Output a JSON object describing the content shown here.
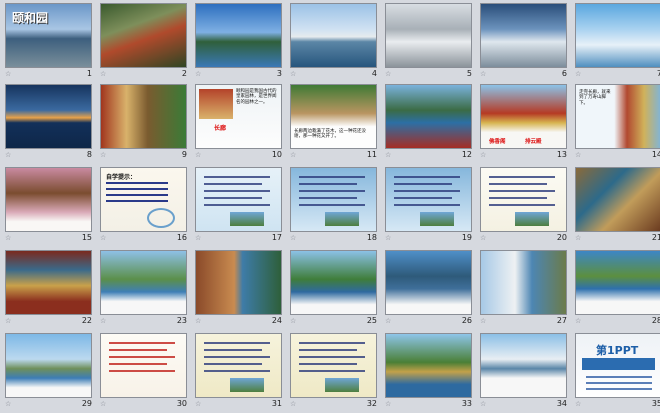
{
  "slides": [
    {
      "n": "1",
      "title": "颐和园",
      "bg": "scene-lake",
      "star": "☆"
    },
    {
      "n": "2",
      "bg": "scene-temple",
      "star": "☆"
    },
    {
      "n": "3",
      "bg": "scene-blue",
      "star": "☆"
    },
    {
      "n": "4",
      "bg": "scene-bridge",
      "star": "☆"
    },
    {
      "n": "5",
      "bg": "scene-winter",
      "star": "☆"
    },
    {
      "n": "6",
      "bg": "scene-snow",
      "star": "☆"
    },
    {
      "n": "7",
      "bg": "scene-bluewinter",
      "star": "☆"
    },
    {
      "n": "8",
      "bg": "scene-sunset",
      "star": "☆"
    },
    {
      "n": "9",
      "bg": "scene-corridor",
      "star": "☆"
    },
    {
      "n": "10",
      "bg": "scene-paper",
      "text": "颐和园是我国古代的皇家园林，是世界闻名的园林之一。",
      "label": "长廊",
      "star": "☆"
    },
    {
      "n": "11",
      "bg": "scene-longcorridor",
      "text": "长廊两边栽满了花木，这一种花还没谢，那一种花又开了。",
      "star": "☆"
    },
    {
      "n": "12",
      "bg": "scene-lakehill",
      "text": "",
      "star": "☆"
    },
    {
      "n": "13",
      "bg": "scene-palace",
      "label1": "佛香阁",
      "label2": "排云殿",
      "star": "☆"
    },
    {
      "n": "14",
      "bg": "scene-pagoda",
      "text": "走完长廊，就来到了万寿山脚下。",
      "star": "☆"
    },
    {
      "n": "15",
      "bg": "scene-blossom",
      "text": "",
      "star": "☆"
    },
    {
      "n": "16",
      "bg": "scene-question",
      "text": "自学提示：",
      "star": "☆"
    },
    {
      "n": "17",
      "bg": "scene-lightblue",
      "text": "",
      "star": "☆"
    },
    {
      "n": "18",
      "bg": "scene-bluepanel",
      "text": "",
      "star": "☆"
    },
    {
      "n": "19",
      "bg": "scene-bluepanel",
      "text": "",
      "star": "☆"
    },
    {
      "n": "20",
      "bg": "scene-yellowtext",
      "text": "",
      "star": "☆"
    },
    {
      "n": "21",
      "bg": "scene-ceiling",
      "star": "☆"
    },
    {
      "n": "22",
      "bg": "scene-painted",
      "star": "☆"
    },
    {
      "n": "23",
      "bg": "scene-hills",
      "text": "",
      "star": "☆"
    },
    {
      "n": "24",
      "bg": "scene-boats",
      "text": "",
      "star": "☆"
    },
    {
      "n": "25",
      "bg": "scene-greenhills",
      "text": "",
      "star": "☆"
    },
    {
      "n": "26",
      "bg": "scene-lakeview",
      "text": "",
      "star": "☆"
    },
    {
      "n": "27",
      "bg": "scene-arch",
      "text": "",
      "star": "☆"
    },
    {
      "n": "28",
      "bg": "scene-island",
      "text": "",
      "star": "☆"
    },
    {
      "n": "29",
      "bg": "scene-longbridge",
      "text": "",
      "star": "☆"
    },
    {
      "n": "30",
      "bg": "scene-redtext",
      "text": "",
      "star": "☆"
    },
    {
      "n": "31",
      "bg": "scene-bluetext",
      "text": "",
      "star": "☆"
    },
    {
      "n": "32",
      "bg": "scene-bluetext",
      "text": "",
      "star": "☆"
    },
    {
      "n": "33",
      "bg": "scene-willow",
      "text": "",
      "star": "☆"
    },
    {
      "n": "34",
      "bg": "scene-bridgetext",
      "text": "",
      "star": "☆"
    },
    {
      "n": "35",
      "bg": "scene-ppt",
      "title": "第1PPT",
      "star": "☆"
    }
  ]
}
